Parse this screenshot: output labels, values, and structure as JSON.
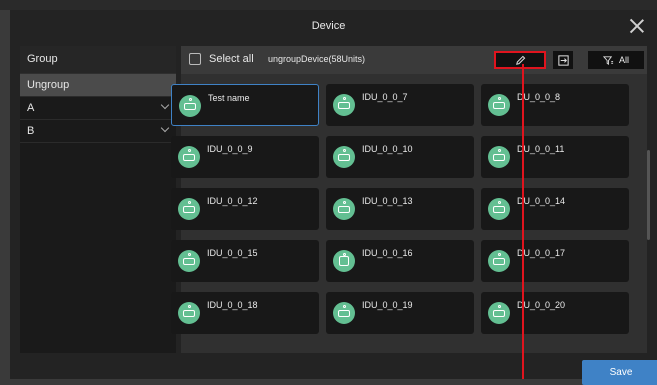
{
  "dialog": {
    "title": "Device"
  },
  "left_panel": {
    "header": "Group",
    "items": [
      {
        "label": "Ungroup",
        "selected": true,
        "expandable": false
      },
      {
        "label": "A",
        "selected": false,
        "expandable": true
      },
      {
        "label": "B",
        "selected": false,
        "expandable": true
      }
    ]
  },
  "toolbar": {
    "select_all_label": "Select all",
    "unit_count": "ungroupDevice(58Units)",
    "edit_icon": "pencil-icon",
    "export_icon": "export-icon",
    "filter_icon": "filter-icon",
    "filter_label": "All"
  },
  "devices": [
    {
      "name": "Test name",
      "icon": "indoor-unit-icon",
      "active": true
    },
    {
      "name": "IDU_0_0_7",
      "icon": "indoor-unit-icon"
    },
    {
      "name": "DU_0_0_8",
      "icon": "indoor-unit-icon"
    },
    {
      "name": "IDU_0_0_9",
      "icon": "indoor-unit-icon"
    },
    {
      "name": "IDU_0_0_10",
      "icon": "indoor-unit-icon"
    },
    {
      "name": "DU_0_0_11",
      "icon": "indoor-unit-icon"
    },
    {
      "name": "IDU_0_0_12",
      "icon": "indoor-unit-icon"
    },
    {
      "name": "IDU_0_0_13",
      "icon": "indoor-unit-icon"
    },
    {
      "name": "DU_0_0_14",
      "icon": "indoor-unit-icon"
    },
    {
      "name": "IDU_0_0_15",
      "icon": "indoor-unit-icon"
    },
    {
      "name": "IDU_0_0_16",
      "icon": "cassette-unit-icon"
    },
    {
      "name": "DU_0_0_17",
      "icon": "indoor-unit-icon"
    },
    {
      "name": "IDU_0_0_18",
      "icon": "indoor-unit-icon"
    },
    {
      "name": "IDU_0_0_19",
      "icon": "indoor-unit-icon"
    },
    {
      "name": "DU_0_0_20",
      "icon": "indoor-unit-icon"
    }
  ],
  "footer": {
    "save_label": "Save"
  },
  "colors": {
    "accent": "#3f82c6",
    "device_icon": "#63bf92",
    "highlight": "#e0141e"
  }
}
